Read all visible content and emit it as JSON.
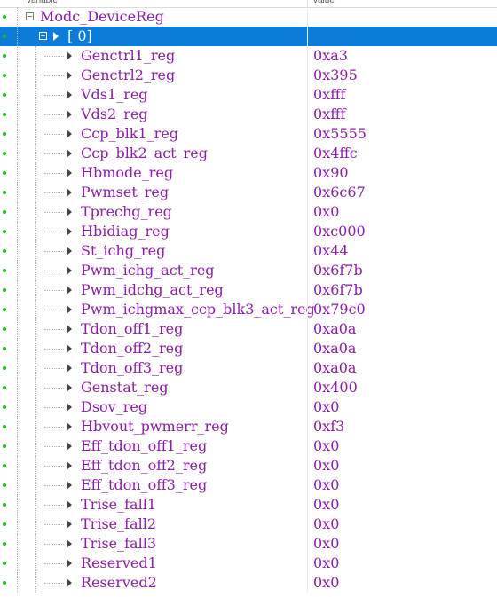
{
  "header": {
    "variable_col": "variable",
    "value_col": "value"
  },
  "root": {
    "name": "Modc_DeviceReg",
    "value": ""
  },
  "selected": {
    "name": "[ 0]",
    "value": ""
  },
  "registers": [
    {
      "name": "Genctrl1_reg",
      "value": "0xa3"
    },
    {
      "name": "Genctrl2_reg",
      "value": "0x395"
    },
    {
      "name": "Vds1_reg",
      "value": "0xfff"
    },
    {
      "name": "Vds2_reg",
      "value": "0xfff"
    },
    {
      "name": "Ccp_blk1_reg",
      "value": "0x5555"
    },
    {
      "name": "Ccp_blk2_act_reg",
      "value": "0x4ffc"
    },
    {
      "name": "Hbmode_reg",
      "value": "0x90"
    },
    {
      "name": "Pwmset_reg",
      "value": "0x6c67"
    },
    {
      "name": "Tprechg_reg",
      "value": "0x0"
    },
    {
      "name": "Hbidiag_reg",
      "value": "0xc000"
    },
    {
      "name": "St_ichg_reg",
      "value": "0x44"
    },
    {
      "name": "Pwm_ichg_act_reg",
      "value": "0x6f7b"
    },
    {
      "name": "Pwm_idchg_act_reg",
      "value": "0x6f7b"
    },
    {
      "name": "Pwm_ichgmax_ccp_blk3_act_reg",
      "value": "0x79c0"
    },
    {
      "name": "Tdon_off1_reg",
      "value": "0xa0a"
    },
    {
      "name": "Tdon_off2_reg",
      "value": "0xa0a"
    },
    {
      "name": "Tdon_off3_reg",
      "value": "0xa0a"
    },
    {
      "name": "Genstat_reg",
      "value": "0x400"
    },
    {
      "name": "Dsov_reg",
      "value": "0x0"
    },
    {
      "name": "Hbvout_pwmerr_reg",
      "value": "0xf3"
    },
    {
      "name": "Eff_tdon_off1_reg",
      "value": "0x0"
    },
    {
      "name": "Eff_tdon_off2_reg",
      "value": "0x0"
    },
    {
      "name": "Eff_tdon_off3_reg",
      "value": "0x0"
    },
    {
      "name": "Trise_fall1",
      "value": "0x0"
    },
    {
      "name": "Trise_fall2",
      "value": "0x0"
    },
    {
      "name": "Trise_fall3",
      "value": "0x0"
    },
    {
      "name": "Reserved1",
      "value": "0x0"
    },
    {
      "name": "Reserved2",
      "value": "0x0"
    }
  ],
  "colors": {
    "selection": "#0b7dd8",
    "text": "#8b1ea8",
    "status_dot": "#22bb22"
  }
}
